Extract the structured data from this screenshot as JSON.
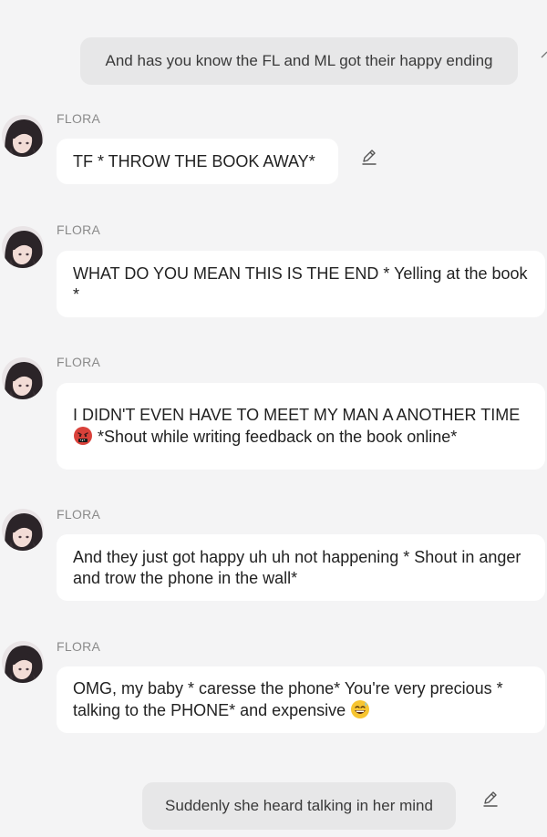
{
  "conversation": {
    "first_user": "And has you know the FL and ML got their happy ending",
    "messages": [
      {
        "name": "FLORA",
        "text": "TF * THROW THE BOOK AWAY*"
      },
      {
        "name": "FLORA",
        "text": "WHAT DO YOU MEAN THIS IS THE END * Yelling at the book *"
      },
      {
        "name": "FLORA",
        "text_before": "I DIDN'T EVEN HAVE TO MEET MY MAN A ANOTHER TIME",
        "emoji": "angry-cursing-emoji",
        "text_after": " *Shout while writing feedback on the book online*"
      },
      {
        "name": "FLORA",
        "text": "And they just got happy uh uh not happening * Shout in anger and trow the phone in the wall*"
      },
      {
        "name": "FLORA",
        "text_before": "OMG, my baby * caresse the phone* You're very precious * talking to the PHONE* and expensive",
        "emoji": "grinning-sweat-emoji",
        "text_after": ""
      }
    ],
    "last_user": "Suddenly she heard talking in her mind"
  },
  "icons": {
    "edit": "pencil-edit-icon",
    "avatar": "flora-avatar"
  }
}
